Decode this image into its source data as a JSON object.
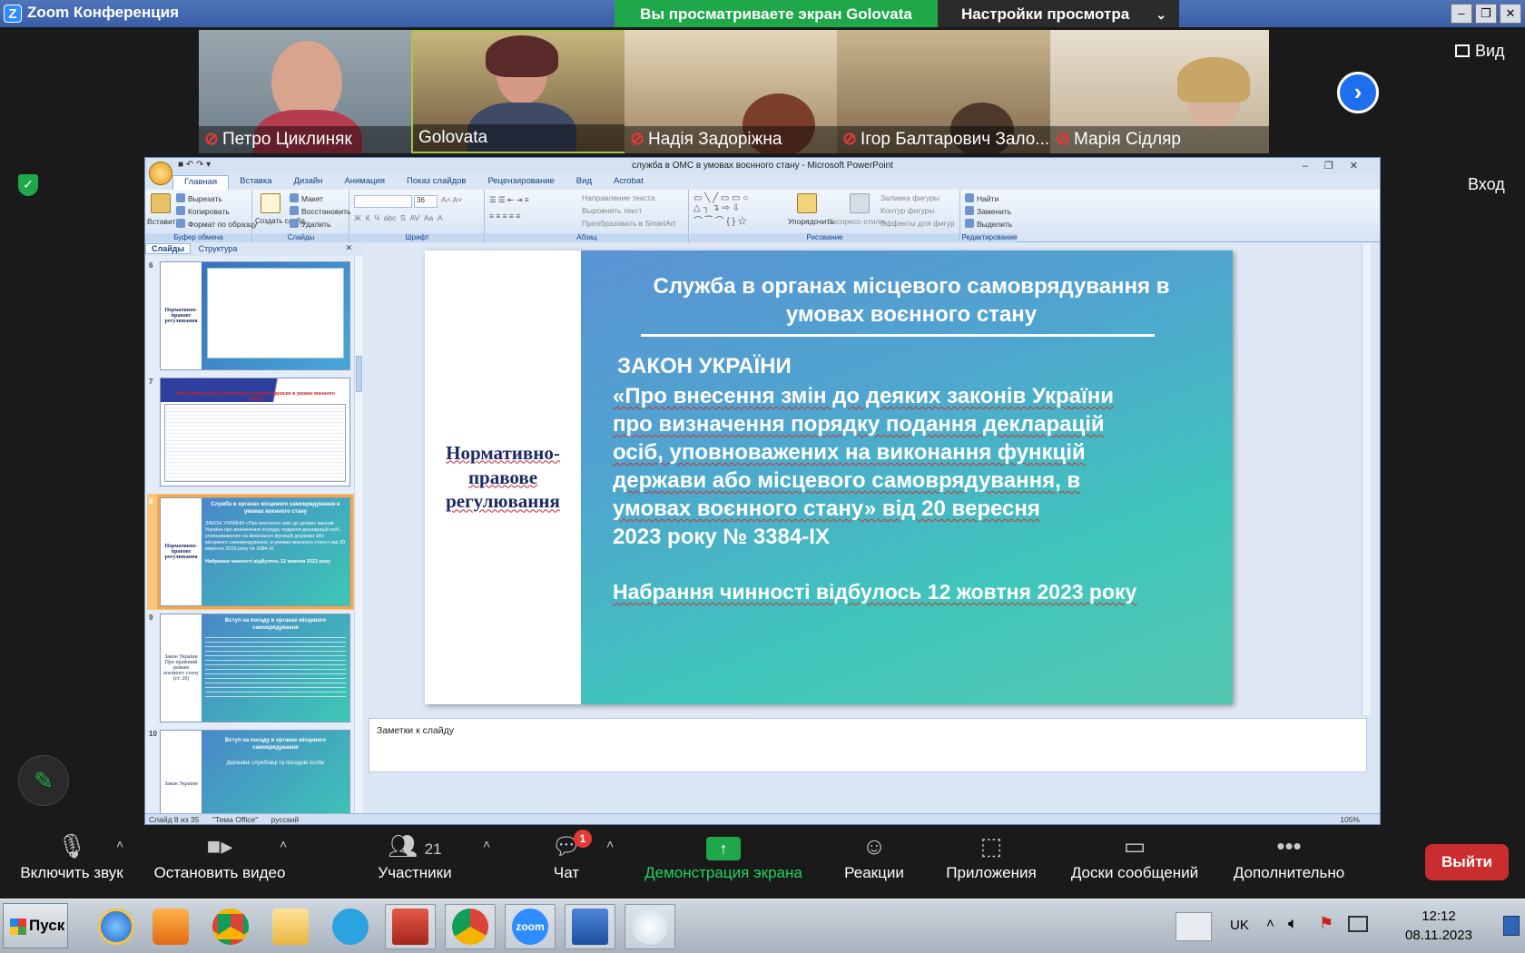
{
  "zoom": {
    "window_title": "Zoom Конференция",
    "logo_letter": "Z",
    "share_banner": "Вы просматриваете экран Golovata",
    "view_settings": "Настройки просмотра",
    "view_button": "Вид",
    "enter_button": "Вход",
    "participants_strip": [
      {
        "name": "Петро Циклиняк",
        "muted": true
      },
      {
        "name": "Golovata",
        "muted": false
      },
      {
        "name": "Надія Задоріжна",
        "muted": true
      },
      {
        "name": "Ігор Балтарович Зало...",
        "muted": true
      },
      {
        "name": "Марія Сідляр",
        "muted": true
      }
    ],
    "toolbar": {
      "unmute": "Включить звук",
      "stop_video": "Остановить видео",
      "participants": "Участники",
      "participants_count": "21",
      "chat": "Чат",
      "chat_badge": "1",
      "share_screen": "Демонстрация экрана",
      "reactions": "Реакции",
      "apps": "Приложения",
      "whiteboards": "Доски сообщений",
      "more": "Дополнительно",
      "leave": "Выйти"
    }
  },
  "ppt": {
    "window_title": "служба в ОМС в умовах воєнного стану - Microsoft PowerPoint",
    "tabs": [
      "Главная",
      "Вставка",
      "Дизайн",
      "Анимация",
      "Показ слайдов",
      "Рецензирование",
      "Вид",
      "Acrobat"
    ],
    "ribbon": {
      "clipboard": {
        "name": "Буфер обмена",
        "paste": "Вставить",
        "cut": "Вырезать",
        "copy": "Копировать",
        "format_painter": "Формат по образцу"
      },
      "slides": {
        "name": "Слайды",
        "new_slide": "Создать слайд",
        "layout": "Макет",
        "reset": "Восстановить",
        "delete": "Удалить"
      },
      "font": {
        "name": "Шрифт",
        "size": "36"
      },
      "paragraph": {
        "name": "Абзац",
        "text_direction": "Направление текста",
        "align_text": "Выровнять текст",
        "smartart": "Преобразовать в SmartArt"
      },
      "drawing": {
        "name": "Рисование",
        "arrange": "Упорядочить",
        "quick_styles": "Экспресс-стили",
        "shape_fill": "Заливка фигуры",
        "shape_outline": "Контур фигуры",
        "shape_effects": "Эффекты для фигур"
      },
      "editing": {
        "name": "Редактирование",
        "find": "Найти",
        "replace": "Заменить",
        "select": "Выделить"
      }
    },
    "panel_tabs": {
      "slides": "Слайды",
      "outline": "Структура"
    },
    "thumbnails": [
      {
        "num": "6",
        "left": "Нормативно-правове регулювання"
      },
      {
        "num": "7",
        "title": "Закон України «Про організацію трудових відносин в умовах воєнного стану»"
      },
      {
        "num": "8",
        "left": "Нормативно-правове регулювання",
        "title": "Служба в органах місцевого самоврядування в умовах воєнного стану",
        "body": "ЗАКОН УКРАЇНИ «Про внесення змін до деяких законів України про визначення порядку подання декларацій осіб, уповноважених на виконання функцій держави або місцевого самоврядування, в умовах воєнного стану» від 20 вересня 2023 року № 3384-IX",
        "foot": "Набрання чинності відбулось 12 жовтня 2023 року"
      },
      {
        "num": "9",
        "left": "Закон України Про правовий режим воєнного стану (ст. 20)",
        "title": "Вступ на посаду в органах місцевого самоврядування"
      },
      {
        "num": "10",
        "left": "Закон України",
        "title": "Вступ на посаду в органах місцевого самоврядування",
        "body": "Державні службовці та посадові особи"
      }
    ],
    "slide": {
      "left_text": "Нормативно-правове регулювання",
      "title_line1": "Служба в органах місцевого самоврядування в",
      "title_line2": "умовах воєнного стану",
      "law_head": "ЗАКОН УКРАЇНИ",
      "law_lines": [
        "«Про внесення змін до деяких законів України",
        "про визначення порядку подання декларацій",
        "осіб, уповноважених на виконання функцій",
        "держави або місцевого самоврядування, в",
        "умовах воєнного стану» від 20 вересня"
      ],
      "law_date": "2023 року № 3384-IX",
      "effective": "Набрання чинності відбулось 12 жовтня 2023 року"
    },
    "notes_placeholder": "Заметки к слайду",
    "status": {
      "slide": "Слайд 8 из 35",
      "theme": "\"Тема Office\"",
      "lang": "русский",
      "zoom": "105%"
    }
  },
  "taskbar": {
    "start": "Пуск",
    "lang": "UK",
    "time": "12:12",
    "date": "08.11.2023",
    "zoom_app_label": "zoom"
  },
  "colors": {
    "zoom_green": "#1fa84a",
    "leave_red": "#c92d2d",
    "slide_gradient_a": "#5a93d4",
    "slide_gradient_b": "#3fc6bb"
  }
}
